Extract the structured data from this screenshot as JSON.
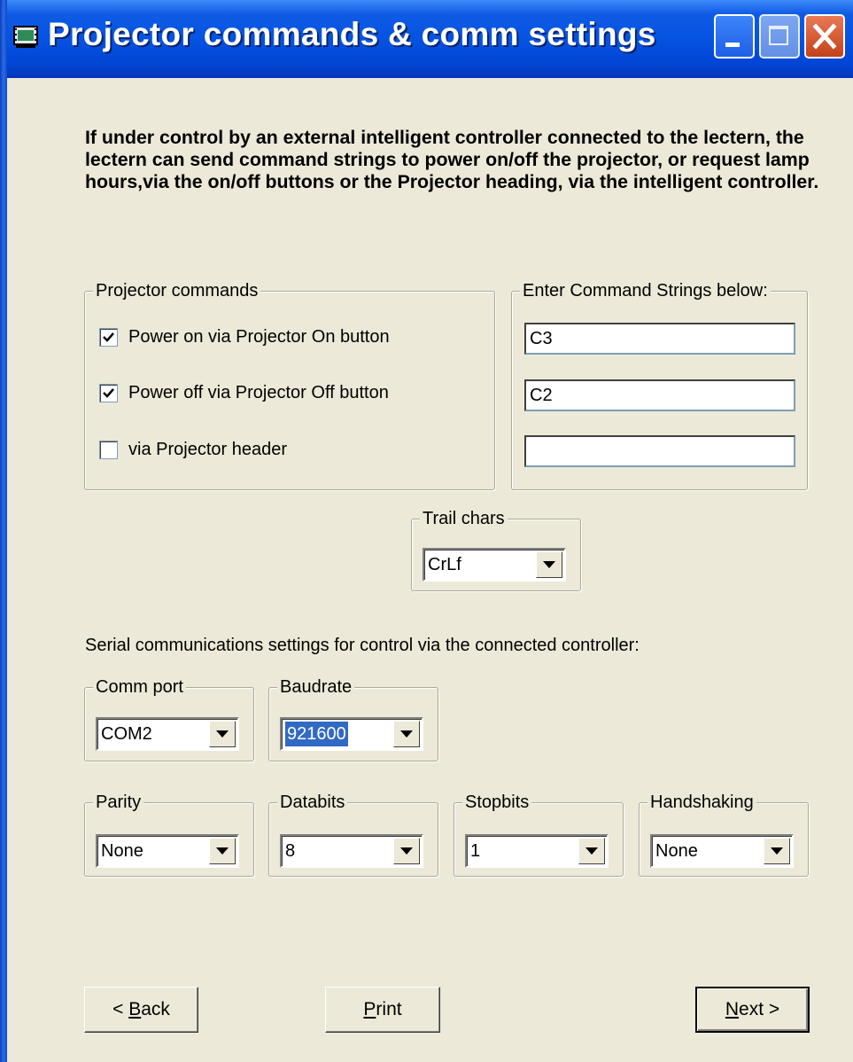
{
  "window": {
    "title": "Projector commands & comm settings",
    "icons": {
      "app": "projector-icon",
      "minimize": "minimize-icon",
      "maximize": "maximize-icon",
      "close": "close-icon"
    },
    "colors": {
      "titlebar": "#0553E2",
      "face": "#ECE9D8",
      "selection": "#316AC5",
      "close": "#C2421A"
    }
  },
  "intro_text": "If under control by an external intelligent controller connected to the lectern, the lectern can send command strings to power on/off the projector, or request lamp hours,via the on/off buttons or the Projector heading, via the intelligent controller.",
  "projector_commands": {
    "legend": "Projector commands",
    "options": [
      {
        "label": "Power on via Projector On button",
        "checked": true
      },
      {
        "label": "Power off via Projector Off button",
        "checked": true
      },
      {
        "label": "via Projector header",
        "checked": false
      }
    ]
  },
  "command_strings": {
    "legend": "Enter Command Strings below:",
    "values": [
      "C3",
      "C2",
      ""
    ]
  },
  "trail_chars": {
    "legend": "Trail chars",
    "value": "CrLf"
  },
  "serial_label": "Serial communications settings for control via the connected controller:",
  "comm_port": {
    "legend": "Comm port",
    "value": "COM2"
  },
  "baudrate": {
    "legend": "Baudrate",
    "value": "921600"
  },
  "parity": {
    "legend": "Parity",
    "value": "None"
  },
  "databits": {
    "legend": "Databits",
    "value": "8"
  },
  "stopbits": {
    "legend": "Stopbits",
    "value": "1"
  },
  "handshaking": {
    "legend": "Handshaking",
    "value": "None"
  },
  "buttons": {
    "back": {
      "prefix": "< ",
      "mnemonic": "B",
      "rest": "ack"
    },
    "print": {
      "mnemonic": "P",
      "rest": "rint"
    },
    "next": {
      "mnemonic": "N",
      "rest": "ext >"
    }
  }
}
